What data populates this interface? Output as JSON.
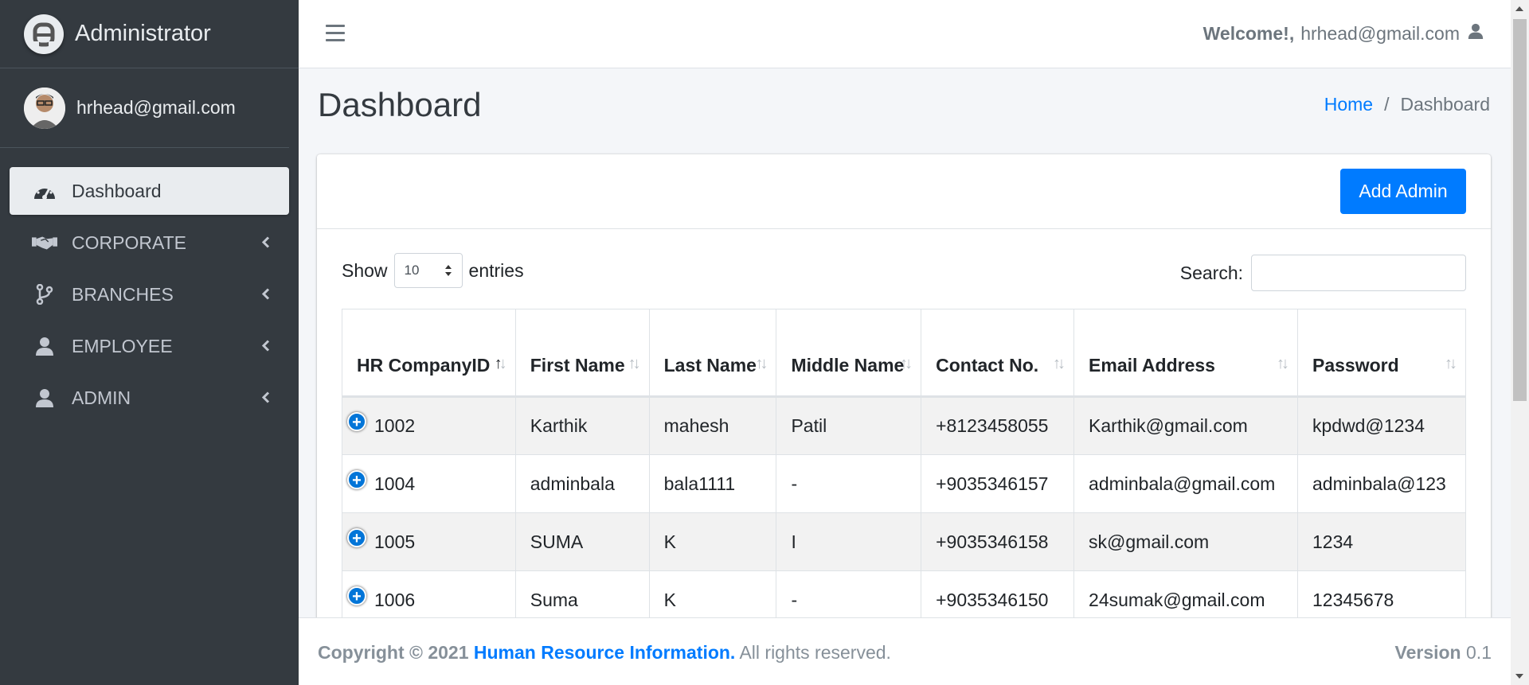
{
  "sidebar": {
    "brand": "Administrator",
    "user": "hrhead@gmail.com",
    "items": [
      {
        "label": "Dashboard"
      },
      {
        "label": "CORPORATE"
      },
      {
        "label": "BRANCHES"
      },
      {
        "label": "EMPLOYEE"
      },
      {
        "label": "ADMIN"
      }
    ]
  },
  "header": {
    "welcome": "Welcome!,",
    "user": "hrhead@gmail.com"
  },
  "page": {
    "title": "Dashboard",
    "breadcrumb": {
      "home": "Home",
      "sep": "/",
      "current": "Dashboard"
    }
  },
  "card": {
    "add_button": "Add Admin",
    "show_label": "Show",
    "entries_value": "10",
    "entries_label": "entries",
    "search_label": "Search:"
  },
  "table": {
    "headers": [
      "HR CompanyID",
      "First Name",
      "Last Name",
      "Middle Name",
      "Contact No.",
      "Email Address",
      "Password"
    ],
    "rows": [
      [
        "1002",
        "Karthik",
        "mahesh",
        "Patil",
        "+8123458055",
        "Karthik@gmail.com",
        "kpdwd@1234"
      ],
      [
        "1004",
        "adminbala",
        "bala1111",
        "-",
        "+9035346157",
        "adminbala@gmail.com",
        "adminbala@123"
      ],
      [
        "1005",
        "SUMA",
        "K",
        "I",
        "+9035346158",
        "sk@gmail.com",
        "1234"
      ],
      [
        "1006",
        "Suma",
        "K",
        "-",
        "+9035346150",
        "24sumak@gmail.com",
        "12345678"
      ]
    ]
  },
  "footer": {
    "copyright": "Copyright © 2021",
    "org": "Human Resource Information.",
    "rights": "All rights reserved.",
    "version_label": "Version",
    "version": "0.1"
  }
}
